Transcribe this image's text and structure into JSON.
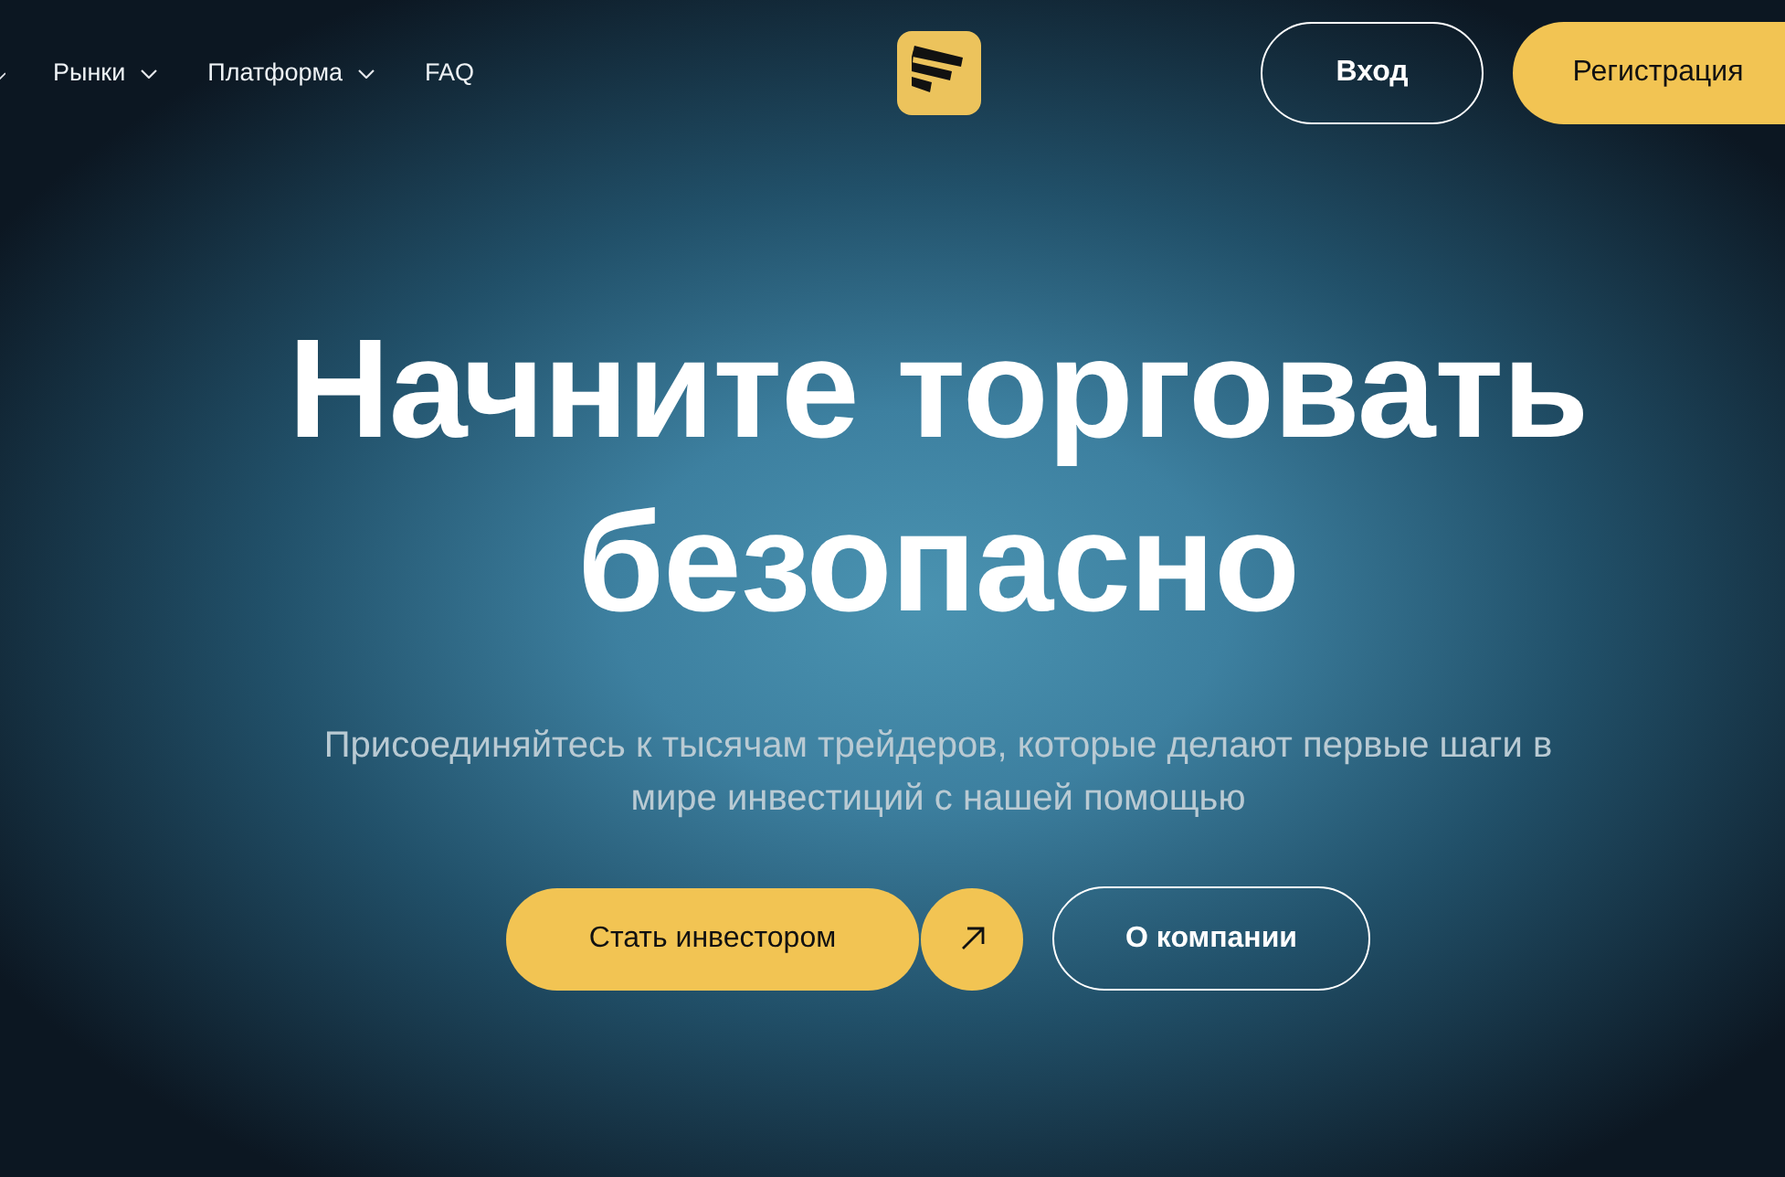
{
  "nav": {
    "items": [
      {
        "label": "Рынки",
        "dropdown": true
      },
      {
        "label": "Платформа",
        "dropdown": true
      },
      {
        "label": "FAQ",
        "dropdown": false
      }
    ]
  },
  "header_buttons": [
    {
      "label": "Вход",
      "kind": "outline"
    },
    {
      "label": "Регистрация",
      "kind": "filled"
    }
  ],
  "hero": {
    "title": "Начните торговать безопасно",
    "subtitle": "Присоединяйтесь к тысячам трейдеров, которые делают первые шаги в мире инвестиций с нашей помощью",
    "actions": [
      {
        "label": "Стать инвестором",
        "kind": "filled",
        "arrow": true
      },
      {
        "label": "О компании",
        "kind": "outline",
        "arrow": false
      }
    ]
  }
}
